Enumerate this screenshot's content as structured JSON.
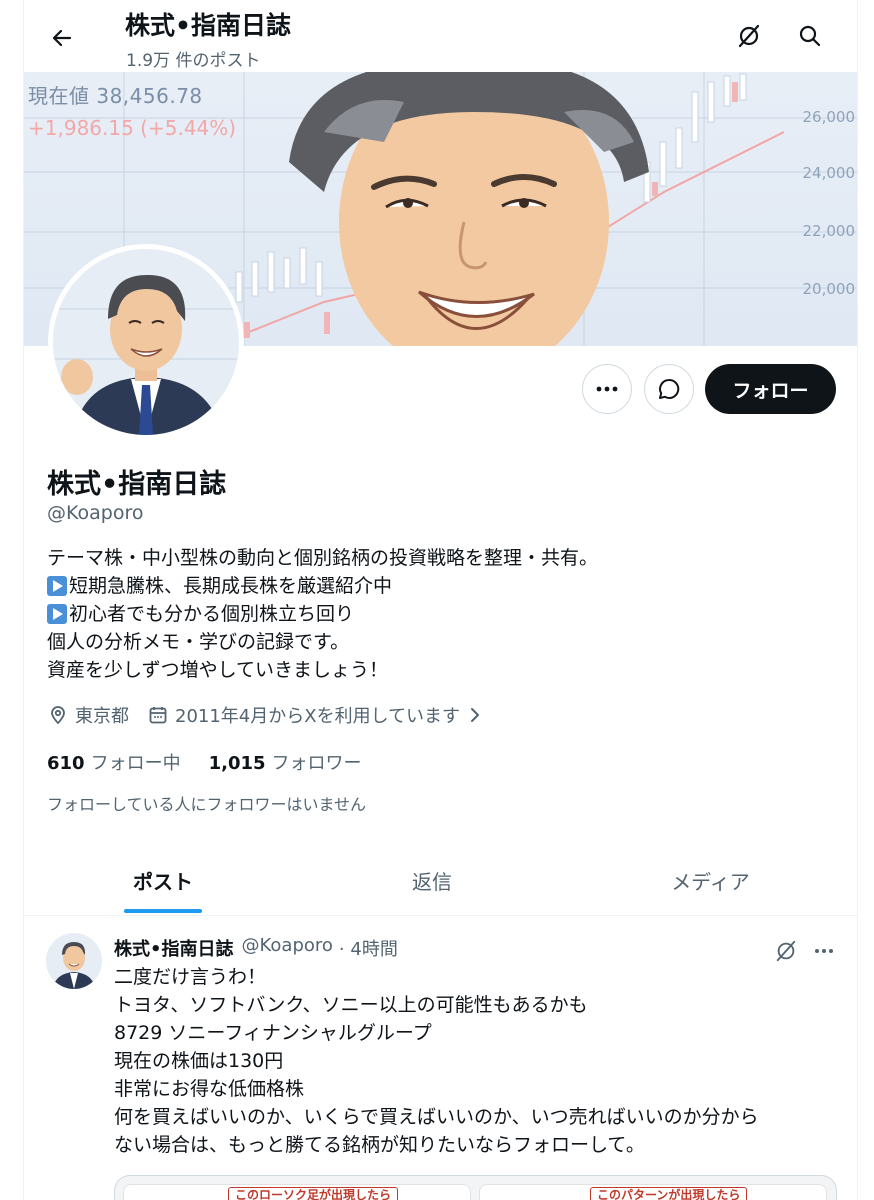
{
  "header": {
    "title": "株式•指南日誌",
    "post_count": "1.9万 件のポスト"
  },
  "banner": {
    "price_text": "現在値 38,456.78",
    "change_text": "+1,986.15 (+5.44%)",
    "axis_ticks": [
      "26,000",
      "24,000",
      "22,000",
      "20,000"
    ]
  },
  "profile": {
    "name": "株式•指南日誌",
    "handle": "@Koaporo",
    "follow_label": "フォロー",
    "bio": [
      "テーマ株・中小型株の動向と個別銘柄の投資戦略を整理・共有。",
      "短期急騰株、長期成長株を厳選紹介中",
      "初心者でも分かる個別株立ち回り",
      "個人の分析メモ・学びの記録です。",
      "資産を少しずつ増やしていきましょう！"
    ],
    "location": "東京都",
    "joined": "2011年4月からXを利用しています",
    "following_count": "610",
    "following_label": "フォロー中",
    "followers_count": "1,015",
    "followers_label": "フォロワー",
    "followed_note": "フォローしている人にフォロワーはいません"
  },
  "tabs": [
    {
      "label": "ポスト",
      "active": true
    },
    {
      "label": "返信",
      "active": false
    },
    {
      "label": "メディア",
      "active": false
    }
  ],
  "post": {
    "name": "株式•指南日誌",
    "handle": "@Koaporo",
    "time": "· 4時間",
    "lines": [
      "二度だけ言うわ！",
      "トヨタ、ソフトバンク、ソニー以上の可能性もあるかも",
      "8729 ソニーフィナンシャルグループ",
      "現在の株価は130円",
      "非常にお得な低価格株",
      "何を買えばいいのか、いくらで買えばいいのか、いつ売ればいいのか分から",
      "ない場合は、もっと勝てる銘柄が知りたいならフォローして。"
    ],
    "media_labels": [
      "このローソク足が出現したら",
      "このパターンが出現したら"
    ]
  },
  "colors": {
    "accent": "#1d9bf0",
    "text": "#0f1419",
    "muted": "#536471",
    "follow_bg": "#0f1419"
  }
}
